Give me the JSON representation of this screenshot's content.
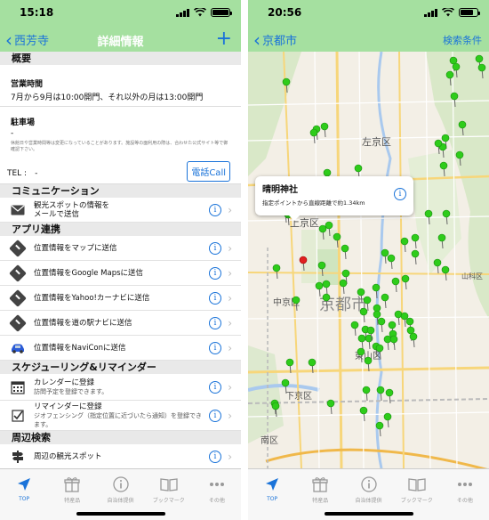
{
  "left": {
    "status_time": "15:18",
    "nav": {
      "back_label": "西芳寺",
      "title": "詳細情報",
      "add": "+"
    },
    "overview": {
      "header": "概要",
      "hours_label": "営業時間",
      "hours_value": "7月から9月は10:00開門、それ以外の月は13:00開門",
      "parking_label": "駐車場",
      "parking_value": "-",
      "note": "休館日や営業時間等は変更になっていることがあります。施設等の面利用の際は、合わせた公式サイト等で御確認下さい。",
      "tel": "TEL :　-",
      "call_button": "電話Call"
    },
    "communication": {
      "header": "コミュニケーション",
      "items": [
        {
          "label": "観光スポットの情報を\nメールで送信"
        }
      ]
    },
    "apps": {
      "header": "アプリ連携",
      "items": [
        {
          "label": "位置情報をマップに送信"
        },
        {
          "label": "位置情報をGoogle Mapsに送信"
        },
        {
          "label": "位置情報をYahoo!カーナビに送信"
        },
        {
          "label": "位置情報を道の駅ナビに送信"
        },
        {
          "label": "位置情報をNaviConに送信"
        }
      ]
    },
    "schedule": {
      "header": "スケジューリング&リマインダー",
      "items": [
        {
          "label": "カレンダーに登録",
          "sub": "訪問予定を登録できます。"
        },
        {
          "label": "リマインダーに登録",
          "sub": "ジオフェンシング（指定位置に近づいたら通知）を登録できます。"
        }
      ]
    },
    "nearby": {
      "header": "周辺検索",
      "items": [
        {
          "label": "周辺の観光スポット"
        }
      ]
    }
  },
  "right": {
    "status_time": "20:56",
    "nav": {
      "back_label": "京都市",
      "right_label": "検索条件"
    },
    "callout": {
      "title": "晴明神社",
      "subtitle": "指定ポイントから直線距離で約1.34km"
    },
    "map_labels": {
      "sakyo": "左京区",
      "kamigyo": "上京区",
      "nakagyo": "中京区",
      "kyoto_city": "京都市",
      "higashiyama": "東山区",
      "shimogyo": "下京区",
      "minami": "南区",
      "yamashina": "山科区"
    }
  },
  "tabs": [
    {
      "label": "TOP",
      "icon": "location-arrow-icon"
    },
    {
      "label": "特産品",
      "icon": "gift-icon"
    },
    {
      "label": "自治体提供",
      "icon": "info-circle-icon"
    },
    {
      "label": "ブックマーク",
      "icon": "book-icon"
    },
    {
      "label": "その他",
      "icon": "more-icon"
    }
  ],
  "colors": {
    "nav_green": "#a5e0a0",
    "link_blue": "#1a73d9",
    "pin_green": "#2ecc1a",
    "pin_red": "#e02020"
  }
}
